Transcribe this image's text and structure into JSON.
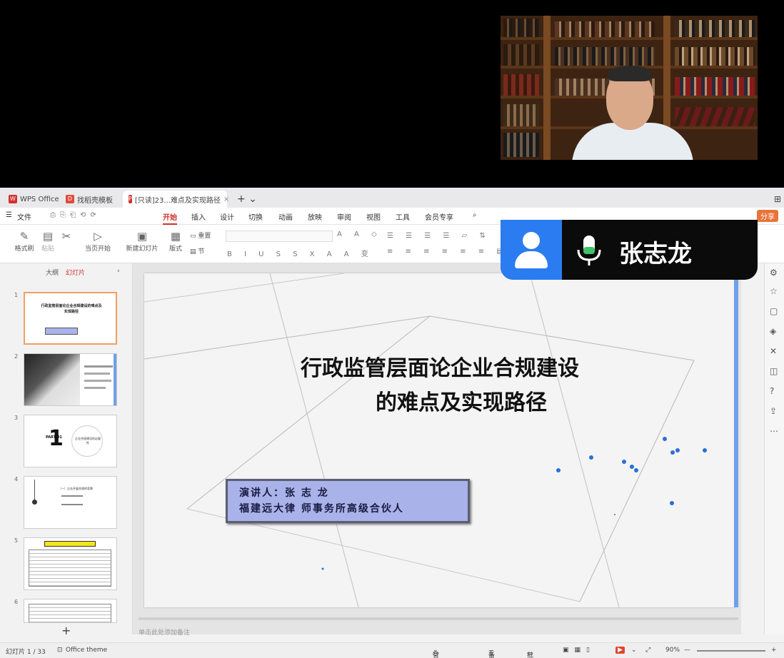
{
  "tabs": [
    {
      "label": "WPS Office",
      "icon": "wps-logo-icon"
    },
    {
      "label": "找稻壳模板",
      "icon": "docer-icon"
    },
    {
      "label": "[只读]23...难点及实现路径",
      "icon": "ppt-file-icon"
    }
  ],
  "menu": {
    "file": "文件",
    "items": [
      "开始",
      "插入",
      "设计",
      "切换",
      "动画",
      "放映",
      "审阅",
      "视图",
      "工具",
      "会员专享"
    ],
    "share": "分享"
  },
  "ribbon": {
    "format_painter": "格式刷",
    "paste": "粘贴",
    "play_from_current": "当页开始",
    "new_slide": "新建幻灯片",
    "layout": "版式",
    "reset": "重置",
    "section": "节"
  },
  "left_panel": {
    "outline_tab": "大纲",
    "slides_tab": "幻灯片",
    "thumbs": [
      {
        "num": "1",
        "title": "行政监管层面论企业合规建设的难点及实现路径"
      },
      {
        "num": "2",
        "title": ""
      },
      {
        "num": "3",
        "title": "企业合规建设的必要性",
        "part": "PART 01"
      },
      {
        "num": "4",
        "title": "（一）企业开展合规的背景"
      },
      {
        "num": "5",
        "title": ""
      },
      {
        "num": "6",
        "title": ""
      }
    ]
  },
  "slide": {
    "title_line1": "行政监管层面论企业合规建设",
    "title_line2": "的难点及实现路径",
    "speaker_line1": "演讲人：张 志 龙",
    "speaker_line2": "福建远大律 师事务所高级合伙人"
  },
  "notes_placeholder": "单击此处添加备注",
  "status": {
    "slide_count": "幻灯片 1 / 33",
    "theme": "Office theme",
    "smart_beautify": "智能美化",
    "notes": "备注",
    "comments": "批注",
    "zoom": "90%"
  },
  "participant": {
    "name": "张志龙",
    "avatar_color": "#2a7cf0"
  },
  "colors": {
    "accent": "#d2302b",
    "speaker_box": "#a9b3ea",
    "slide_edge": "#6fa0e8"
  }
}
